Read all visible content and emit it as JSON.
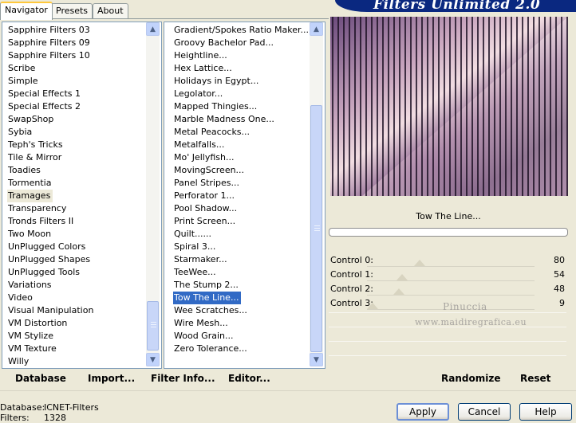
{
  "tabs": [
    "Navigator",
    "Presets",
    "About"
  ],
  "banner_title": "Filters Unlimited 2.0",
  "categories": {
    "items": [
      "Sapphire Filters 03",
      "Sapphire Filters 09",
      "Sapphire Filters 10",
      "Scribe",
      "Simple",
      "Special Effects 1",
      "Special Effects 2",
      "SwapShop",
      "Sybia",
      "Teph's Tricks",
      "Tile & Mirror",
      "Toadies",
      "Tormentia",
      "Tramages",
      "Transparency",
      "Tronds Filters II",
      "Two Moon",
      "UnPlugged Colors",
      "UnPlugged Shapes",
      "UnPlugged Tools",
      "Variations",
      "Video",
      "Visual Manipulation",
      "VM Distortion",
      "VM Stylize",
      "VM Texture",
      "Willy"
    ],
    "selected": "Tramages"
  },
  "filters": {
    "items": [
      "Gradient/Spokes Ratio Maker...",
      "Groovy Bachelor Pad...",
      "Heightline...",
      "Hex Lattice...",
      "Holidays in Egypt...",
      "Legolator...",
      "Mapped Thingies...",
      "Marble Madness One...",
      "Metal Peacocks...",
      "Metalfalls...",
      "Mo' Jellyfish...",
      "MovingScreen...",
      "Panel Stripes...",
      "Perforator 1...",
      "Pool Shadow...",
      "Print Screen...",
      "Quilt......",
      "Spiral 3...",
      "Starmaker...",
      "TeeWee...",
      "The Stump 2...",
      "Tow The Line...",
      "Wee Scratches...",
      "Wire Mesh...",
      "Wood Grain...",
      "Zero Tolerance..."
    ],
    "selected": "Tow The Line..."
  },
  "current_filter": "Tow The Line...",
  "controls": [
    {
      "label": "Control 0:",
      "value": "80",
      "level": 80
    },
    {
      "label": "Control 1:",
      "value": "54",
      "level": 54
    },
    {
      "label": "Control 2:",
      "value": "48",
      "level": 48
    },
    {
      "label": "Control 3:",
      "value": "9",
      "level": 9
    }
  ],
  "watermark": {
    "line1": "Pinuccia",
    "line2": "www.maidiregrafica.eu"
  },
  "bottom_buttons": {
    "database": "Database",
    "import": "Import...",
    "filter_info": "Filter Info...",
    "editor": "Editor...",
    "randomize": "Randomize",
    "reset": "Reset"
  },
  "status": {
    "database_label": "Database:",
    "database_value": "ICNET-Filters",
    "filters_label": "Filters:",
    "filters_value": "1328"
  },
  "dialog_buttons": {
    "apply": "Apply",
    "cancel": "Cancel",
    "help": "Help"
  },
  "colors": {
    "selection": "#316ac5",
    "banner": "#0a2880",
    "preview_dark": "#3d2350",
    "preview_light": "#f2dde2"
  },
  "icons": {
    "scroll_up": "chevron-up-icon",
    "scroll_down": "chevron-down-icon"
  }
}
